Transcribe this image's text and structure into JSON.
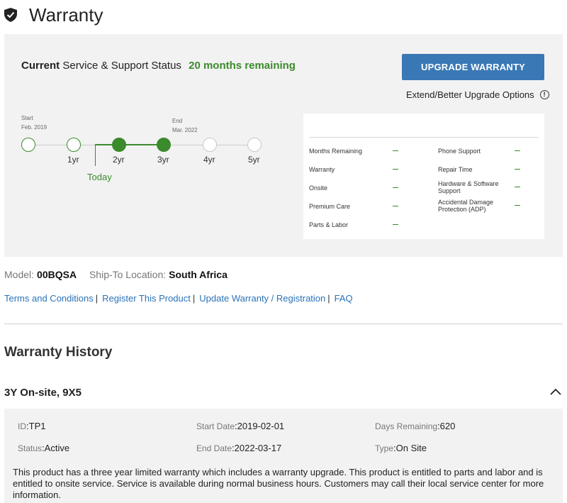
{
  "header": {
    "title": "Warranty",
    "icon": "shield-check-icon"
  },
  "status": {
    "current_bold": "Current",
    "current_rest": "Service & Support Status",
    "remaining": "20 months remaining",
    "upgrade_button": "UPGRADE WARRANTY",
    "extend_link": "Extend/Better Upgrade Options",
    "info_glyph": "!"
  },
  "timeline": {
    "start_label": "Start",
    "start_date": "Feb. 2019",
    "end_label": "End",
    "end_date": "Mar. 2022",
    "years": [
      "1yr",
      "2yr",
      "3yr",
      "4yr",
      "5yr"
    ],
    "today_label": "Today"
  },
  "details": {
    "left": [
      {
        "label": "Months Remaining",
        "value": "—"
      },
      {
        "label": "Warranty",
        "value": "—"
      },
      {
        "label": "Onsite",
        "value": "—"
      },
      {
        "label": "Premium Care",
        "value": "—"
      },
      {
        "label": "Parts & Labor",
        "value": "—"
      }
    ],
    "right": [
      {
        "label": "Phone Support",
        "value": "—"
      },
      {
        "label": "Repair Time",
        "value": "—"
      },
      {
        "label": "Hardware & Software Support",
        "value": "—"
      },
      {
        "label": "Accidental Damage Protection (ADP)",
        "value": "—"
      }
    ]
  },
  "product": {
    "model_label": "Model:",
    "model_value": "00BQSA",
    "ship_label": "Ship-To Location:",
    "ship_value": "South Africa"
  },
  "links": {
    "terms": "Terms and Conditions",
    "register": "Register This Product",
    "update": "Update Warranty / Registration",
    "faq": "FAQ",
    "separator": "|"
  },
  "history": {
    "title": "Warranty History",
    "plan": {
      "name": "3Y On-site, 9X5",
      "id_label": "ID",
      "id_value": "TP1",
      "status_label": "Status",
      "status_value": "Active",
      "start_label": "Start Date",
      "start_value": "2019-02-01",
      "end_label": "End Date",
      "end_value": "2022-03-17",
      "days_label": "Days Remaining",
      "days_value": "620",
      "type_label": "Type",
      "type_value": "On Site",
      "description": "This product has a three year limited warranty which includes a warranty upgrade. This product is entitled to parts and labor and is entitled to onsite service. Service is available during normal business hours. Customers may call their local service center for more information."
    }
  },
  "colors": {
    "accent_green": "#3b8a2c",
    "button_blue": "#3a78b5",
    "link_blue": "#2a73b8",
    "panel_gray": "#f2f2f2"
  }
}
